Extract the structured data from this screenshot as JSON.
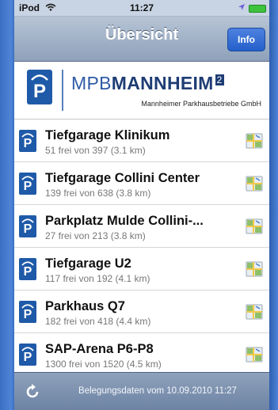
{
  "status_bar": {
    "carrier": "iPod",
    "time": "11:27"
  },
  "nav": {
    "title": "Übersicht",
    "info_label": "Info"
  },
  "banner": {
    "brand_prefix": "MPB",
    "brand_main": "MANNHEIM",
    "brand_mark": "2",
    "tagline": "Mannheimer Parkhausbetriebe GmbH",
    "logo_letter": "P"
  },
  "parking": [
    {
      "name": "Tiefgarage Klinikum",
      "detail": "51 frei von 397  (3.1 km)",
      "icon": "P"
    },
    {
      "name": "Tiefgarage Collini Center",
      "detail": "139 frei von 638  (3.8 km)",
      "icon": "P"
    },
    {
      "name": "Parkplatz Mulde Collini-...",
      "detail": "27 frei von 213  (3.8 km)",
      "icon": "P"
    },
    {
      "name": "Tiefgarage U2",
      "detail": "117 frei von 192  (4.1 km)",
      "icon": "P"
    },
    {
      "name": "Parkhaus Q7",
      "detail": "182 frei von 418  (4.4 km)",
      "icon": "P"
    },
    {
      "name": "SAP-Arena P6-P8",
      "detail": "1300 frei von 1520  (4.5 km)",
      "icon": "P"
    }
  ],
  "toolbar": {
    "updated_text": "Belegungsdaten vom 10.09.2010 11:27"
  },
  "colors": {
    "brand_blue": "#1f5aa8",
    "nav_gradient_top": "#b7c4d6",
    "info_button": "#2e6ad6",
    "battery": "#3ec23e"
  },
  "icons": {
    "status": [
      "wifi-icon",
      "location-arrow-icon",
      "battery-icon"
    ],
    "row_left": "parking-p-icon",
    "row_right": "map-icon",
    "toolbar": "refresh-icon"
  }
}
